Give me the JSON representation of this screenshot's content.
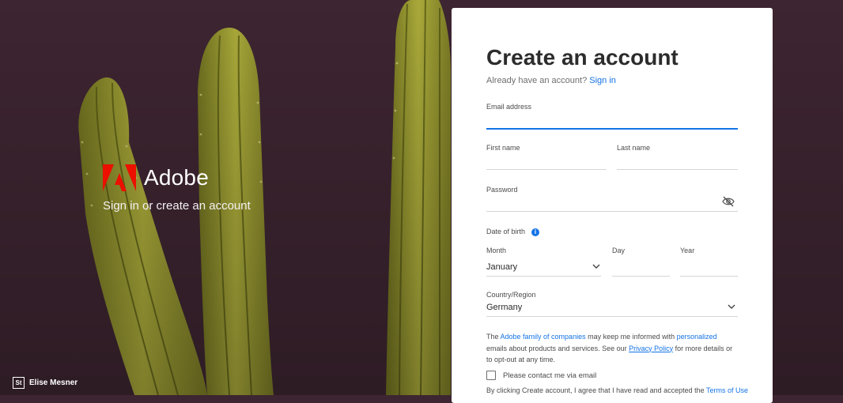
{
  "brand": {
    "name": "Adobe",
    "tagline": "Sign in or create an account",
    "logo_color": "#eb1000"
  },
  "photo_credit": {
    "icon_text": "St",
    "name": "Elise Mesner"
  },
  "form": {
    "title": "Create an account",
    "have_account": "Already have an account?",
    "sign_in": "Sign in",
    "email_label": "Email address",
    "first_name_label": "First name",
    "last_name_label": "Last name",
    "password_label": "Password",
    "dob_label": "Date of birth",
    "month_label": "Month",
    "month_value": "January",
    "day_label": "Day",
    "year_label": "Year",
    "country_label": "Country/Region",
    "country_value": "Germany",
    "consent": {
      "part1": "The ",
      "family_link": "Adobe family of companies",
      "part2": " may keep me informed with ",
      "personalized_link": "personalized",
      "part3": " emails about products and services. See our ",
      "privacy_link": "Privacy Policy",
      "part4": " for more details or to opt-out at any time."
    },
    "contact_checkbox": "Please contact me via email",
    "terms": {
      "text": "By clicking Create account, I agree that I have read and accepted the ",
      "terms_link": "Terms of Use"
    }
  },
  "colors": {
    "background": "#3d2531",
    "accent": "#1473e6"
  }
}
